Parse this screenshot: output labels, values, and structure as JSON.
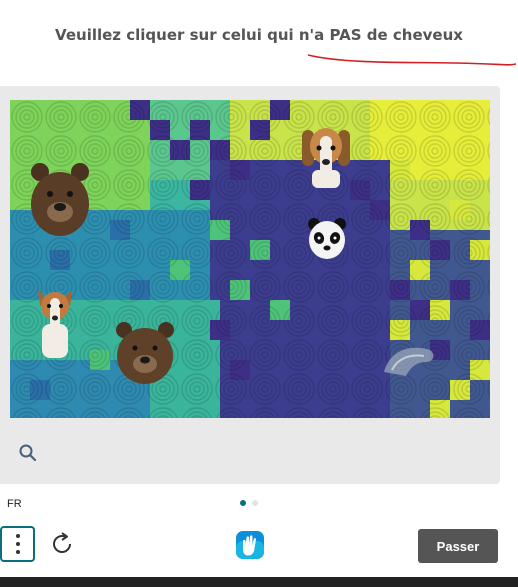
{
  "header": {
    "prompt": "Veuillez cliquer sur celui qui n'a PAS de cheveux"
  },
  "challenge": {
    "image_description_items": [
      "bear",
      "beagle",
      "panda",
      "jack-russell",
      "bear",
      "hairless-creature"
    ]
  },
  "footer": {
    "language": "FR",
    "skip_label": "Passer",
    "page_indicator": {
      "current": 1,
      "total": 2
    }
  },
  "colors": {
    "accent": "#0a6e80",
    "skip_button": "#555555",
    "annotation_line": "#d02020"
  }
}
